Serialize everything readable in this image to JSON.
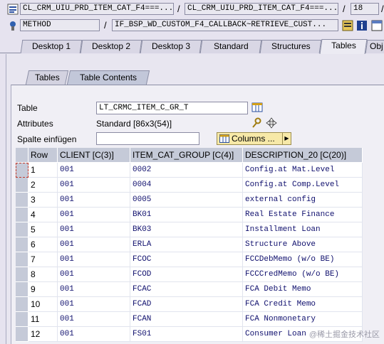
{
  "context": {
    "row1": {
      "field1": "CL_CRM_UIU_PRD_ITEM_CAT_F4===...",
      "sep1": "/",
      "field2": "CL_CRM_UIU_PRD_ITEM_CAT_F4===...",
      "sep2": "/",
      "field3": "18",
      "sep3": "/"
    },
    "row2": {
      "type_field": "METHOD",
      "sep": "/",
      "method_field": "IF_BSP_WD_CUSTOM_F4_CALLBACK~RETRIEVE_CUST..."
    }
  },
  "main_tabs": [
    "Desktop 1",
    "Desktop 2",
    "Desktop 3",
    "Standard",
    "Structures",
    "Tables",
    "Obj"
  ],
  "sub_tabs": [
    "Tables",
    "Table Contents"
  ],
  "form": {
    "table_label": "Table",
    "table_value": "LT_CRMC_ITEM_C_GR_T",
    "attributes_label": "Attributes",
    "attributes_value": "Standard [86x3(54)]",
    "insert_label": "Spalte einfügen",
    "insert_value": "",
    "columns_button": "Columns ..."
  },
  "table": {
    "headers": [
      "Row",
      "CLIENT [C(3)]",
      "ITEM_CAT_GROUP [C(4)]",
      "DESCRIPTION_20 [C(20)]"
    ],
    "rows": [
      [
        "1",
        "001",
        "0002",
        "Config.at Mat.Level"
      ],
      [
        "2",
        "001",
        "0004",
        "Config.at Comp.Level"
      ],
      [
        "3",
        "001",
        "0005",
        "external config"
      ],
      [
        "4",
        "001",
        "BK01",
        "Real Estate Finance"
      ],
      [
        "5",
        "001",
        "BK03",
        "Installment Loan"
      ],
      [
        "6",
        "001",
        "ERLA",
        "Structure Above"
      ],
      [
        "7",
        "001",
        "FCOC",
        "FCCDebMemo (w/o BE)"
      ],
      [
        "8",
        "001",
        "FCOD",
        "FCCCredMemo (w/o BE)"
      ],
      [
        "9",
        "001",
        "FCAC",
        "FCA Debit Memo"
      ],
      [
        "10",
        "001",
        "FCAD",
        "FCA Credit Memo"
      ],
      [
        "11",
        "001",
        "FCAN",
        "FCA Nonmonetary"
      ],
      [
        "12",
        "001",
        "FS01",
        "Consumer Loan"
      ]
    ]
  },
  "watermark": "@稀土掘金技术社区",
  "colors": {
    "background": "#e6e3ef",
    "header": "#c5cad8",
    "cell_text": "#10106e",
    "button": "#f7e9a8"
  }
}
